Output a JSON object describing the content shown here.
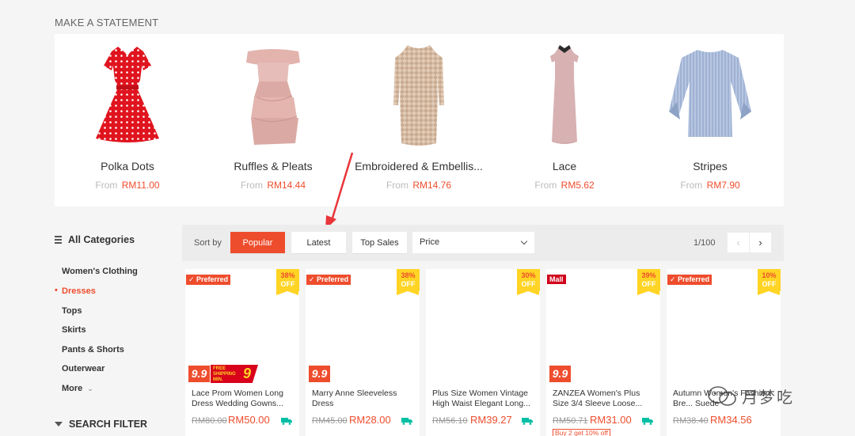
{
  "section_title": "MAKE A STATEMENT",
  "statement_items": [
    {
      "name": "Polka Dots",
      "from": "From",
      "price": "RM11.00"
    },
    {
      "name": "Ruffles & Pleats",
      "from": "From",
      "price": "RM14.44"
    },
    {
      "name": "Embroidered & Embellis...",
      "from": "From",
      "price": "RM14.76"
    },
    {
      "name": "Lace",
      "from": "From",
      "price": "RM5.62"
    },
    {
      "name": "Stripes",
      "from": "From",
      "price": "RM7.90"
    }
  ],
  "sidebar": {
    "all_categories": "All Categories",
    "items": [
      "Women's Clothing",
      "Dresses",
      "Tops",
      "Skirts",
      "Pants & Shorts",
      "Outerwear",
      "More"
    ],
    "search_filter": "SEARCH FILTER"
  },
  "sortbar": {
    "label": "Sort by",
    "popular": "Popular",
    "latest": "Latest",
    "top_sales": "Top Sales",
    "price": "Price",
    "page": "1/100",
    "prev": "‹",
    "next": "›"
  },
  "products": [
    {
      "tag": "Preferred",
      "off_pct": "38%",
      "off": "OFF",
      "badge": "9.9",
      "free_shipping": "FREE SHIPPING MIN. SPEND",
      "fs_num": "9",
      "name": "Lace Prom Women Long Dress Wedding Gowns...",
      "old_price": "RM80.00",
      "new_price": "RM50.00"
    },
    {
      "tag": "Preferred",
      "off_pct": "38%",
      "off": "OFF",
      "badge": "9.9",
      "name": "Marry Anne Sleeveless Dress",
      "old_price": "RM45.00",
      "new_price": "RM28.00"
    },
    {
      "off_pct": "30%",
      "off": "OFF",
      "name": "Plus Size Women Vintage High Waist Elegant Long...",
      "old_price": "RM56.10",
      "new_price": "RM39.27"
    },
    {
      "tag": "Mall",
      "off_pct": "39%",
      "off": "OFF",
      "badge": "9.9",
      "name": "ZANZEA Women's Plus Size 3/4 Sleeve Loose...",
      "old_price": "RM50.71",
      "new_price": "RM31.00",
      "promo": "Buy 2 get 10% off"
    },
    {
      "tag": "Preferred",
      "off_pct": "10%",
      "off": "OFF",
      "name": "Autumn Women's Fashion Bre... Suede",
      "old_price": "RM38.40",
      "new_price": "RM34.56"
    }
  ],
  "watermark": "月梦吃",
  "colors": {
    "accent": "#ee4d2d",
    "badge_yellow": "#ffd424",
    "annotation_arrow": "#e8363a"
  }
}
